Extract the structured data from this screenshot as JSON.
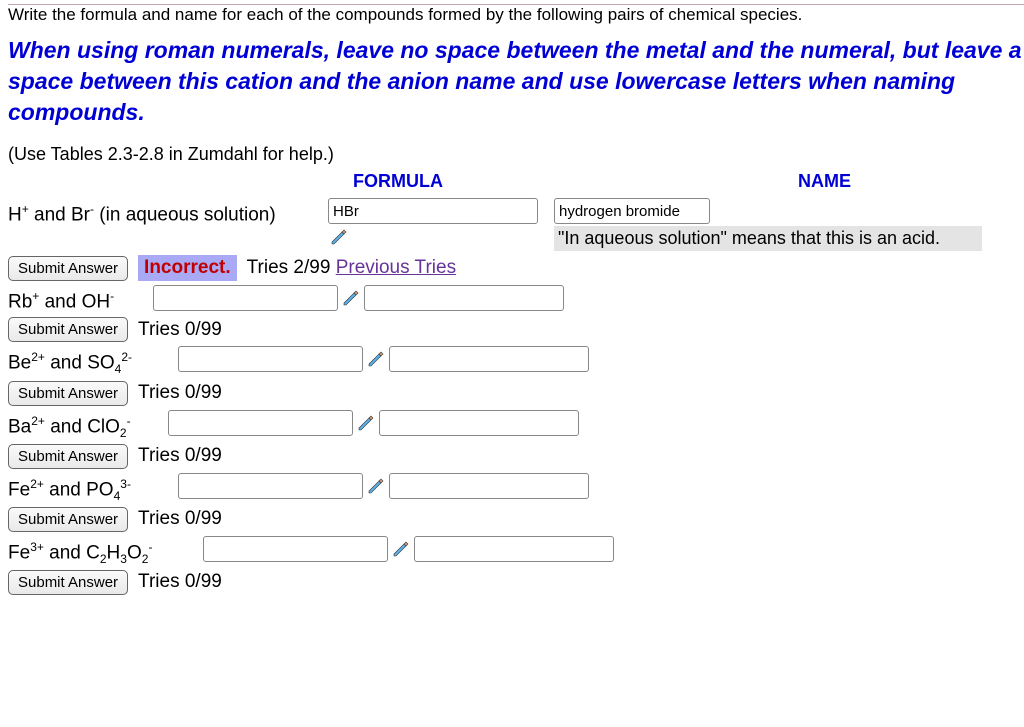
{
  "question": "Write the formula and name for each of the compounds formed by the following pairs of chemical species.",
  "instructions": "When using roman numerals, leave no space between the metal and the numeral, but leave a space between this cation and the anion name and use lowercase letters when naming compounds.",
  "helpText": "(Use Tables 2.3-2.8 in Zumdahl for help.)",
  "headers": {
    "formula": "FORMULA",
    "name": "NAME"
  },
  "row1": {
    "speciesPrefix": "H",
    "speciesSup1": "+",
    "speciesMid": " and Br",
    "speciesSup2": "-",
    "speciesSuffix": " (in aqueous solution)",
    "formulaValue": "HBr",
    "nameValue": "hydrogen bromide",
    "feedback": "\"In aqueous solution\" means that this is an acid."
  },
  "submit": "Submit Answer",
  "status1": {
    "badge": "Incorrect.",
    "tries": "Tries 2/99",
    "link": "Previous Tries"
  },
  "tries0": "Tries 0/99",
  "row2": {
    "p1": "Rb",
    "s1": "+",
    "mid": " and OH",
    "s2": "-"
  },
  "row3": {
    "p1": "Be",
    "s1": "2+",
    "mid": " and SO",
    "sub": "4",
    "s2": "2-"
  },
  "row4": {
    "p1": "Ba",
    "s1": "2+",
    "mid": " and ClO",
    "sub": "2",
    "s2": "-"
  },
  "row5": {
    "p1": "Fe",
    "s1": "2+",
    "mid": " and PO",
    "sub": "4",
    "s2": "3-"
  },
  "row6": {
    "p1": "Fe",
    "s1": "3+",
    "mid": " and C",
    "sub1": "2",
    "p2": "H",
    "sub2": "3",
    "p3": "O",
    "sub3": "2",
    "s2": "-"
  }
}
